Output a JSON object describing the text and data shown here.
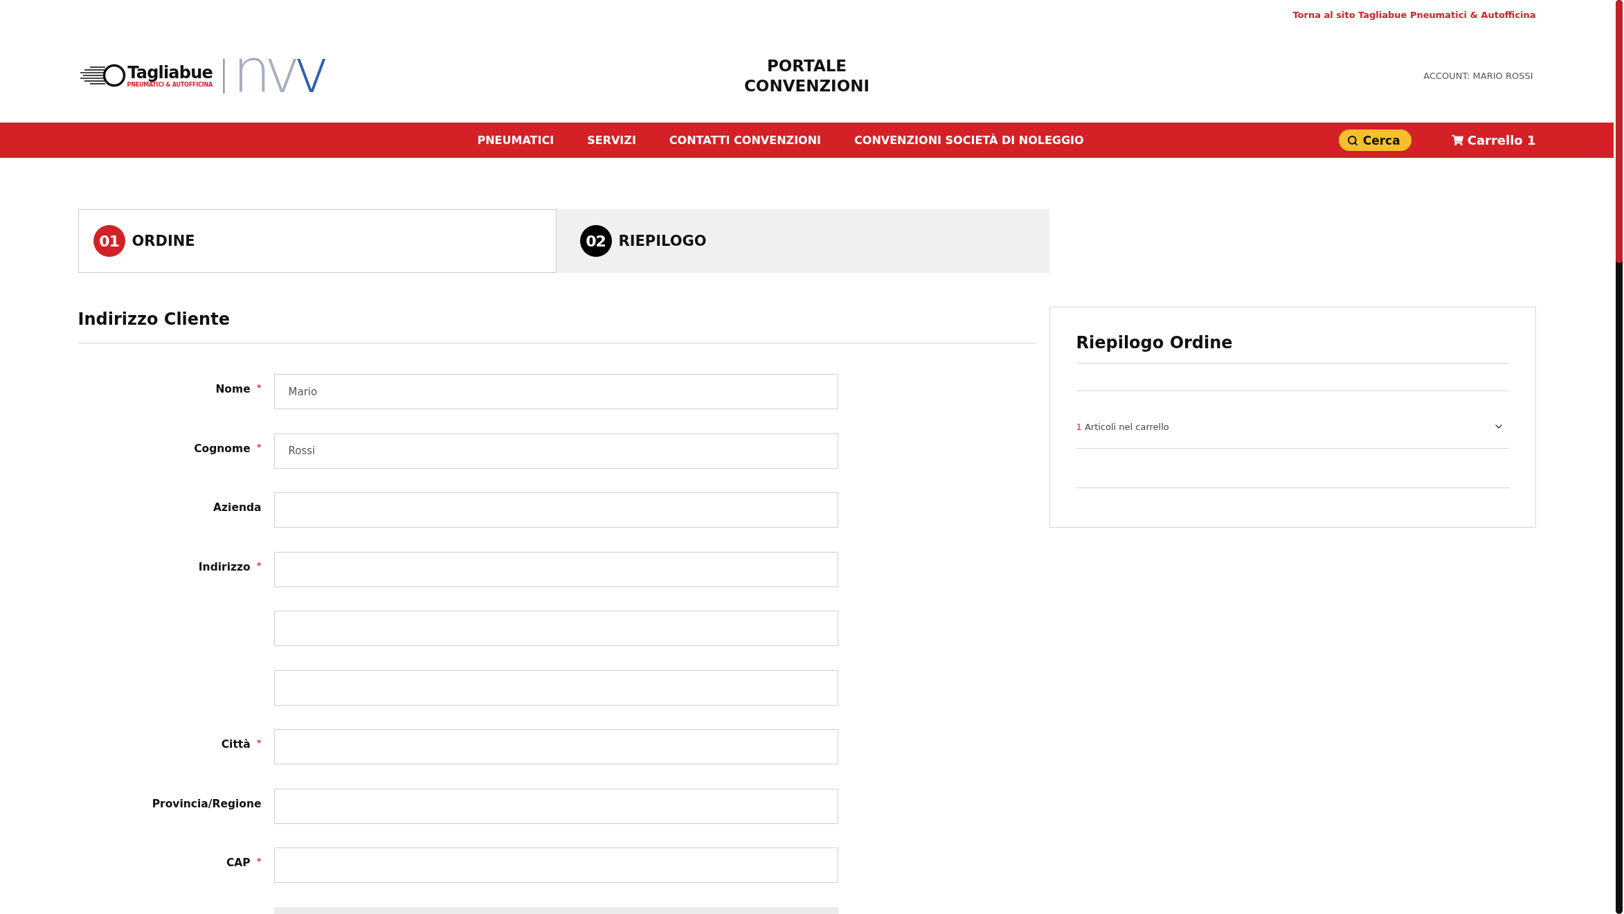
{
  "top_link": "Torna al sito Tagliabue Pneumatici & Autofficina",
  "logo": {
    "name": "Tagliabue",
    "tagline": "PNEUMATICI & AUTOFFICINA",
    "partner": "nvv"
  },
  "header": {
    "title": "PORTALE CONVENZIONI",
    "account": "ACCOUNT: MARIO ROSSI"
  },
  "nav": {
    "items": [
      {
        "label": "PNEUMATICI"
      },
      {
        "label": "SERVIZI"
      },
      {
        "label": "CONTATTI CONVENZIONI"
      },
      {
        "label": "CONVENZIONI SOCIETÀ DI NOLEGGIO"
      }
    ],
    "search": "Cerca",
    "cart": "Carrello 1"
  },
  "steps": [
    {
      "number": "01",
      "label": "ORDINE",
      "selected": true
    },
    {
      "number": "02",
      "label": "RIEPILOGO",
      "selected": false
    }
  ],
  "address_form": {
    "title": "Indirizzo Cliente",
    "fields": [
      {
        "label": "Nome",
        "required_mark": "*",
        "value": "Mario",
        "disabled": false
      },
      {
        "label": "Cognome",
        "required_mark": "*",
        "value": "Rossi",
        "disabled": false
      },
      {
        "label": "Azienda",
        "disabled": false
      },
      {
        "label": "Indirizzo",
        "required_mark": "*",
        "disabled": false
      },
      {
        "disabled": false
      },
      {
        "disabled": false
      },
      {
        "label": "Città",
        "required_mark": "*",
        "disabled": false
      },
      {
        "label": "Provincia/Regione",
        "disabled": false
      },
      {
        "label": "CAP",
        "required_mark": "*",
        "disabled": false
      },
      {
        "disabled": true
      }
    ]
  },
  "order_summary": {
    "title": "Riepilogo Ordine",
    "cart_items": {
      "count": "1",
      "label": "Articoli nel carrello",
      "expanded": false
    }
  }
}
